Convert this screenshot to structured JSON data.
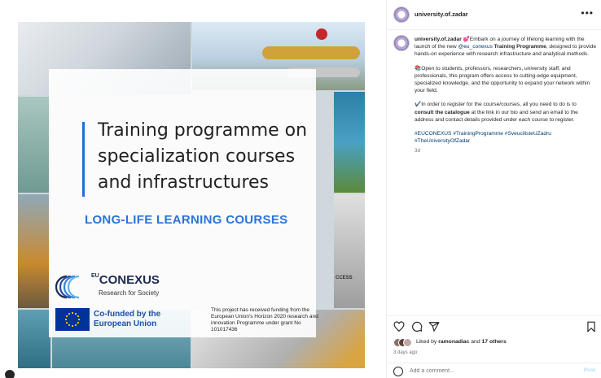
{
  "media": {
    "headline": "Training programme on specialization courses and infrastructures",
    "subheadline": "LONG-LIFE LEARNING COURSES",
    "logo_prefix": "EU",
    "logo_name": "CONEXUS",
    "logo_tagline": "Research for Society",
    "cofunded": "Co-funded by the European Union",
    "funding_note": "This project has received funding from the European Union's Horizon 2020 research and innovation Programme under grant No 101017436",
    "ccess_label": "CCESS"
  },
  "header": {
    "username": "university.of.zadar",
    "more_icon": "more-horizontal-icon"
  },
  "caption": {
    "username": "university.of.zadar",
    "p1_a": "💕Embark on a journey of lifelong learning with the launch of the new ",
    "p1_mention": "@eu_conexus",
    "p1_b": " ",
    "p1_bold": "Training Programme",
    "p1_c": ", designed to provide hands-on experience with research infrastructure and analytical methods.",
    "p2": "📚Open to students, professors, researchers, university staff, and professionals, this program offers access to cutting-edge equipment, specialized knowledge, and the opportunity to expand your network within your field.",
    "p3_a": "✔️In order to register for the course/courses, all you need to do is to ",
    "p3_bold": "consult the catalogue",
    "p3_b": " at the link in our bio and send an email to the address and contact details provided under each course to register.",
    "hashtags": "#EUCONEXUS #TrainingProgramme #SveucilisteUZadru #TheUniversityOfZadar",
    "age": "3d"
  },
  "actions": {
    "icons": [
      "heart-icon",
      "comment-icon",
      "share-icon",
      "bookmark-icon"
    ]
  },
  "likes": {
    "prefix": "Liked by ",
    "user": "ramonadiac",
    "middle": " and ",
    "others": "17 others"
  },
  "time_ago": "3 days ago",
  "comment": {
    "placeholder": "Add a comment...",
    "post_label": "Post"
  },
  "colors": {
    "accent_blue": "#2b73d8",
    "link_blue": "#00376b",
    "eu_blue": "#003399",
    "eu_star": "#ffcc00",
    "muted": "#737373"
  }
}
